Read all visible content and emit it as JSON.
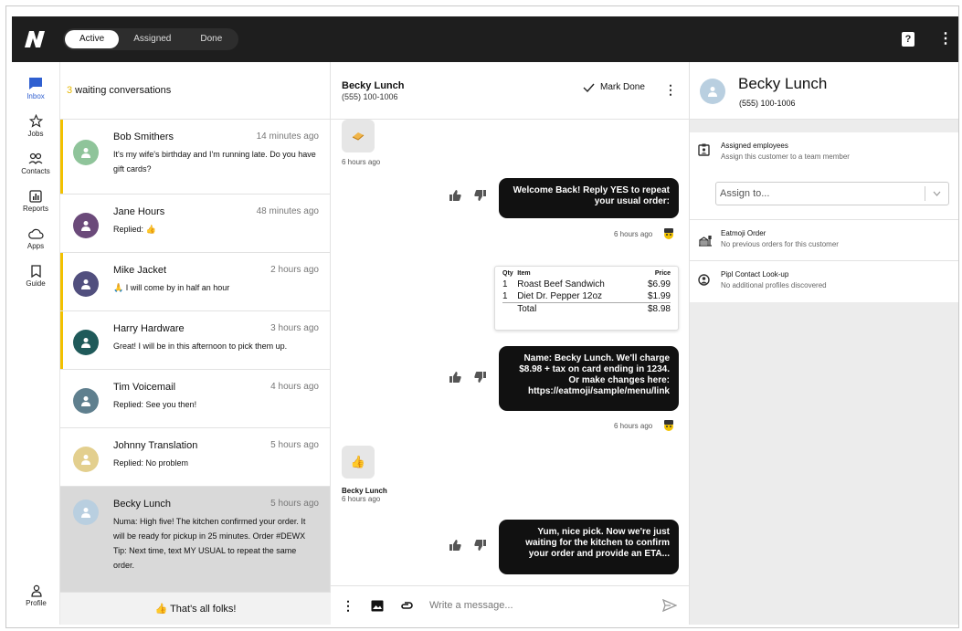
{
  "topbar": {
    "tabs": [
      {
        "label": "Active",
        "active": true
      },
      {
        "label": "Assigned",
        "active": false
      },
      {
        "label": "Done",
        "active": false
      }
    ],
    "help_icon": "help-icon",
    "menu_icon": "kebab-icon"
  },
  "leftnav": {
    "items": [
      {
        "label": "Inbox",
        "icon": "chat-icon",
        "active": true
      },
      {
        "label": "Jobs",
        "icon": "star-icon",
        "active": false
      },
      {
        "label": "Contacts",
        "icon": "people-icon",
        "active": false
      },
      {
        "label": "Reports",
        "icon": "chart-icon",
        "active": false
      },
      {
        "label": "Apps",
        "icon": "cloud-icon",
        "active": false
      },
      {
        "label": "Guide",
        "icon": "bookmark-icon",
        "active": false
      }
    ],
    "profile_label": "Profile"
  },
  "convlist": {
    "waiting_count": "3",
    "waiting_label": "waiting conversations",
    "items": [
      {
        "name": "Bob Smithers",
        "time": "14 minutes ago",
        "preview": "It's my wife's birthday and I'm running late. Do you have gift cards?",
        "avatar_color": "#8fc49a",
        "unread": true
      },
      {
        "name": "Jane Hours",
        "time": "48 minutes ago",
        "preview": "Replied: 👍",
        "avatar_color": "#6b4a7a",
        "unread": false
      },
      {
        "name": "Mike Jacket",
        "time": "2 hours ago",
        "preview": "🙏 I will come by in half an hour",
        "avatar_color": "#514f7e",
        "unread": true
      },
      {
        "name": "Harry Hardware",
        "time": "3 hours ago",
        "preview": "Great! I will be in this afternoon to pick them up.",
        "avatar_color": "#1f5a5a",
        "unread": true
      },
      {
        "name": "Tim Voicemail",
        "time": "4 hours ago",
        "preview": "Replied: See you then!",
        "avatar_color": "#5f7f8e",
        "unread": false
      },
      {
        "name": "Johnny Translation",
        "time": "5 hours ago",
        "preview": "Replied: No problem",
        "avatar_color": "#e3cf8e",
        "unread": false
      },
      {
        "name": "Becky Lunch",
        "time": "5 hours ago",
        "preview": "Numa: High five! The kitchen confirmed your order. It will be ready for pickup in 25 minutes. Order #DEWX Tip: Next time, text MY USUAL to repeat the same order.",
        "avatar_color": "#b9cfe0",
        "selected": true
      }
    ],
    "footer": "👍 That's all folks!"
  },
  "chat": {
    "contact_name": "Becky Lunch",
    "contact_phone": "(555) 100-1006",
    "mark_done": "Mark Done",
    "messages": {
      "in1_time": "6 hours ago",
      "out1_text": "Welcome Back! Reply YES to repeat your usual order:",
      "out1_time": "6 hours ago",
      "out2_text": "Name: Becky Lunch. We'll charge $8.98 + tax on card ending in 1234.   Or make changes here: https://eatmoji/sample/menu/link",
      "out2_time": "6 hours ago",
      "in2_sender": "Becky Lunch",
      "in2_time": "6 hours ago",
      "out3_text": "Yum, nice pick. Now we're just waiting for the kitchen to confirm your order and provide an ETA..."
    },
    "receipt": {
      "headers": {
        "qty": "Qty",
        "item": "Item",
        "price": "Price"
      },
      "rows": [
        {
          "qty": "1",
          "item": "Roast Beef Sandwich",
          "price": "$6.99"
        },
        {
          "qty": "1",
          "item": "Diet Dr. Pepper 12oz",
          "price": "$1.99"
        }
      ],
      "total_label": "Total",
      "total_value": "$8.98"
    },
    "composer_placeholder": "Write a message..."
  },
  "details": {
    "name": "Becky Lunch",
    "phone": "(555) 100-1006",
    "assigned_title": "Assigned employees",
    "assigned_sub": "Assign this customer to a team member",
    "assign_placeholder": "Assign to...",
    "order_title": "Eatmoji Order",
    "order_sub": "No previous orders for this customer",
    "pipl_title": "Pipl Contact Look-up",
    "pipl_sub": "No additional profiles discovered"
  }
}
